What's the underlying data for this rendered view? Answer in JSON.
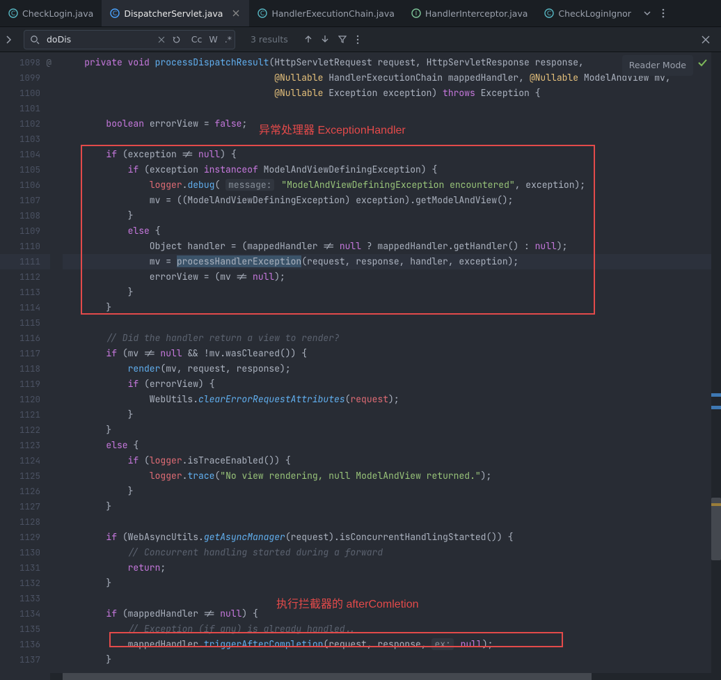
{
  "tabs": [
    {
      "label": "CheckLogin.java",
      "iconColor": "#56b6c2",
      "active": false
    },
    {
      "label": "DispatcherServlet.java",
      "iconColor": "#4aa3ff",
      "active": true
    },
    {
      "label": "HandlerExecutionChain.java",
      "iconColor": "#56b6c2",
      "active": false
    },
    {
      "label": "HandlerInterceptor.java",
      "iconColor": "#56b6c2",
      "active": false
    },
    {
      "label": "CheckLoginIgnor",
      "iconColor": "#56b6c2",
      "active": false,
      "truncated": true
    }
  ],
  "find": {
    "query": "doDis",
    "results": "3 results",
    "cc": "Cc",
    "w": "W",
    "re": ".*"
  },
  "reader_mode": "Reader Mode",
  "gutter_start": 1098,
  "gutter_end": 1137,
  "current_line": 1111,
  "annotations": {
    "label1": "异常处理器 ExceptionHandler",
    "label2": "执行拦截器的 afterComletion"
  },
  "code": [
    {
      "n": 1098,
      "at": true,
      "t": [
        [
          0,
          "    "
        ],
        [
          15,
          "private"
        ],
        [
          0,
          " "
        ],
        [
          15,
          "void"
        ],
        [
          0,
          " "
        ],
        [
          4,
          "processDispatchResult"
        ],
        [
          0,
          "(HttpServletRequest request, HttpServletResponse response,"
        ]
      ]
    },
    {
      "n": 1099,
      "t": [
        [
          0,
          "                                       "
        ],
        [
          8,
          "@Nullable"
        ],
        [
          0,
          " HandlerExecutionChain mappedHandler, "
        ],
        [
          8,
          "@Nullable"
        ],
        [
          0,
          " ModelAndView mv,"
        ]
      ]
    },
    {
      "n": 1100,
      "t": [
        [
          0,
          "                                       "
        ],
        [
          8,
          "@Nullable"
        ],
        [
          0,
          " Exception exception) "
        ],
        [
          15,
          "throws"
        ],
        [
          0,
          " Exception {"
        ]
      ]
    },
    {
      "n": 1101,
      "t": [
        [
          0,
          ""
        ]
      ]
    },
    {
      "n": 1102,
      "t": [
        [
          0,
          "        "
        ],
        [
          15,
          "boolean"
        ],
        [
          0,
          " errorView = "
        ],
        [
          15,
          "false"
        ],
        [
          0,
          ";"
        ]
      ]
    },
    {
      "n": 1103,
      "t": [
        [
          0,
          ""
        ]
      ]
    },
    {
      "n": 1104,
      "t": [
        [
          0,
          "        "
        ],
        [
          15,
          "if"
        ],
        [
          0,
          " (exception != "
        ],
        [
          15,
          "null"
        ],
        [
          0,
          ") {"
        ]
      ]
    },
    {
      "n": 1105,
      "t": [
        [
          0,
          "            "
        ],
        [
          15,
          "if"
        ],
        [
          0,
          " (exception "
        ],
        [
          15,
          "instanceof"
        ],
        [
          0,
          " ModelAndViewDefiningException) {"
        ]
      ]
    },
    {
      "n": 1106,
      "t": [
        [
          0,
          "                "
        ],
        [
          9,
          "logger"
        ],
        [
          0,
          "."
        ],
        [
          3,
          "debug"
        ],
        [
          0,
          "( "
        ],
        [
          20,
          "message:"
        ],
        [
          0,
          " "
        ],
        [
          6,
          "\"ModelAndViewDefiningException encountered\""
        ],
        [
          0,
          ", exception);"
        ]
      ]
    },
    {
      "n": 1107,
      "t": [
        [
          0,
          "                mv = ((ModelAndViewDefiningException) exception).getModelAndView();"
        ]
      ]
    },
    {
      "n": 1108,
      "t": [
        [
          0,
          "            }"
        ]
      ]
    },
    {
      "n": 1109,
      "t": [
        [
          0,
          "            "
        ],
        [
          15,
          "else"
        ],
        [
          0,
          " {"
        ]
      ]
    },
    {
      "n": 1110,
      "t": [
        [
          0,
          "                Object handler = (mappedHandler != "
        ],
        [
          15,
          "null"
        ],
        [
          0,
          " ? mappedHandler.getHandler() : "
        ],
        [
          15,
          "null"
        ],
        [
          0,
          ");"
        ]
      ]
    },
    {
      "n": 1111,
      "hl": true,
      "t": [
        [
          0,
          "                mv = "
        ],
        [
          21,
          "process"
        ],
        [
          21,
          "HandlerException"
        ],
        [
          0,
          "(request, response, handler, exception);"
        ]
      ]
    },
    {
      "n": 1112,
      "t": [
        [
          0,
          "                errorView = (mv != "
        ],
        [
          15,
          "null"
        ],
        [
          0,
          ");"
        ]
      ]
    },
    {
      "n": 1113,
      "t": [
        [
          0,
          "            }"
        ]
      ]
    },
    {
      "n": 1114,
      "t": [
        [
          0,
          "        }"
        ]
      ]
    },
    {
      "n": 1115,
      "t": [
        [
          0,
          ""
        ]
      ]
    },
    {
      "n": 1116,
      "t": [
        [
          0,
          "        "
        ],
        [
          7,
          "// Did the handler return a view to render?"
        ]
      ]
    },
    {
      "n": 1117,
      "t": [
        [
          0,
          "        "
        ],
        [
          15,
          "if"
        ],
        [
          0,
          " (mv != "
        ],
        [
          15,
          "null"
        ],
        [
          0,
          " && !mv.wasCleared()) {"
        ]
      ]
    },
    {
      "n": 1118,
      "t": [
        [
          0,
          "            "
        ],
        [
          3,
          "render"
        ],
        [
          0,
          "(mv, request, response);"
        ]
      ]
    },
    {
      "n": 1119,
      "t": [
        [
          0,
          "            "
        ],
        [
          15,
          "if"
        ],
        [
          0,
          " (errorView) {"
        ]
      ]
    },
    {
      "n": 1120,
      "t": [
        [
          0,
          "                WebUtils."
        ],
        [
          5,
          "clearErrorRequestAttributes"
        ],
        [
          0,
          "("
        ],
        [
          9,
          "request"
        ],
        [
          0,
          ");"
        ]
      ]
    },
    {
      "n": 1121,
      "t": [
        [
          0,
          "            }"
        ]
      ]
    },
    {
      "n": 1122,
      "t": [
        [
          0,
          "        }"
        ]
      ]
    },
    {
      "n": 1123,
      "t": [
        [
          0,
          "        "
        ],
        [
          15,
          "else"
        ],
        [
          0,
          " {"
        ]
      ]
    },
    {
      "n": 1124,
      "t": [
        [
          0,
          "            "
        ],
        [
          15,
          "if"
        ],
        [
          0,
          " ("
        ],
        [
          9,
          "logger"
        ],
        [
          0,
          ".isTraceEnabled()) {"
        ]
      ]
    },
    {
      "n": 1125,
      "t": [
        [
          0,
          "                "
        ],
        [
          9,
          "logger"
        ],
        [
          0,
          "."
        ],
        [
          3,
          "trace"
        ],
        [
          0,
          "("
        ],
        [
          6,
          "\"No view rendering, null ModelAndView returned.\""
        ],
        [
          0,
          ");"
        ]
      ]
    },
    {
      "n": 1126,
      "t": [
        [
          0,
          "            }"
        ]
      ]
    },
    {
      "n": 1127,
      "t": [
        [
          0,
          "        }"
        ]
      ]
    },
    {
      "n": 1128,
      "t": [
        [
          0,
          ""
        ]
      ]
    },
    {
      "n": 1129,
      "t": [
        [
          0,
          "        "
        ],
        [
          15,
          "if"
        ],
        [
          0,
          " (WebAsyncUtils."
        ],
        [
          5,
          "getAsyncManager"
        ],
        [
          0,
          "(request).isConcurrentHandlingStarted()) {"
        ]
      ]
    },
    {
      "n": 1130,
      "t": [
        [
          0,
          "            "
        ],
        [
          7,
          "// Concurrent handling started during a forward"
        ]
      ]
    },
    {
      "n": 1131,
      "t": [
        [
          0,
          "            "
        ],
        [
          15,
          "return"
        ],
        [
          0,
          ";"
        ]
      ]
    },
    {
      "n": 1132,
      "t": [
        [
          0,
          "        }"
        ]
      ]
    },
    {
      "n": 1133,
      "t": [
        [
          0,
          ""
        ]
      ]
    },
    {
      "n": 1134,
      "t": [
        [
          0,
          "        "
        ],
        [
          15,
          "if"
        ],
        [
          0,
          " (mappedHandler != "
        ],
        [
          15,
          "null"
        ],
        [
          0,
          ") {"
        ]
      ]
    },
    {
      "n": 1135,
      "t": [
        [
          0,
          "            "
        ],
        [
          7,
          "// Exception (if any) is already handled.."
        ]
      ]
    },
    {
      "n": 1136,
      "t": [
        [
          0,
          "            mappedHandler."
        ],
        [
          3,
          "triggerAfterCompletion"
        ],
        [
          0,
          "(request, response, "
        ],
        [
          20,
          "ex:"
        ],
        [
          0,
          " "
        ],
        [
          15,
          "null"
        ],
        [
          0,
          ");"
        ]
      ]
    },
    {
      "n": 1137,
      "t": [
        [
          0,
          "        }"
        ]
      ]
    }
  ]
}
